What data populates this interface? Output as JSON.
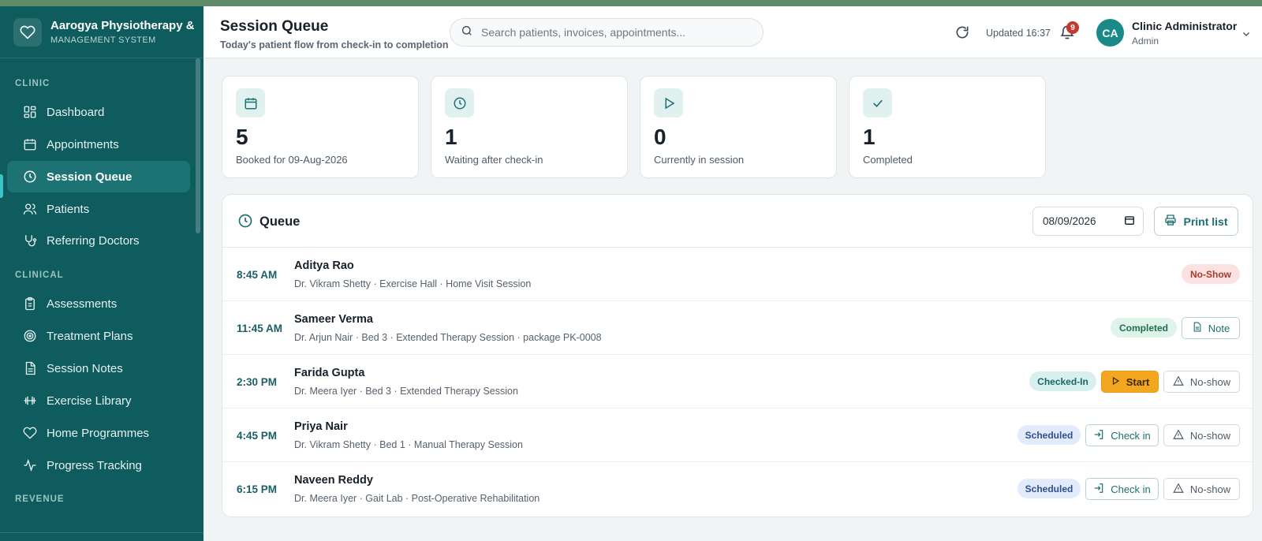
{
  "brand": {
    "name": "Aarogya Physiotherapy & I",
    "subtitle": "MANAGEMENT SYSTEM"
  },
  "sidebar": {
    "sections": [
      {
        "label": "CLINIC"
      },
      {
        "label": "CLINICAL"
      },
      {
        "label": "REVENUE"
      }
    ],
    "items": [
      {
        "label": "Dashboard",
        "icon": "dashboard-icon"
      },
      {
        "label": "Appointments",
        "icon": "calendar-icon"
      },
      {
        "label": "Session Queue",
        "icon": "clock-icon",
        "active": true
      },
      {
        "label": "Patients",
        "icon": "users-icon"
      },
      {
        "label": "Referring Doctors",
        "icon": "stethoscope-icon"
      },
      {
        "label": "Assessments",
        "icon": "clipboard-icon"
      },
      {
        "label": "Treatment Plans",
        "icon": "target-icon"
      },
      {
        "label": "Session Notes",
        "icon": "document-icon"
      },
      {
        "label": "Exercise Library",
        "icon": "dumbbell-icon"
      },
      {
        "label": "Home Programmes",
        "icon": "heart-icon"
      },
      {
        "label": "Progress Tracking",
        "icon": "activity-icon"
      }
    ]
  },
  "header": {
    "title": "Session Queue",
    "subtitle": "Today's patient flow from check-in to completion",
    "search_placeholder": "Search patients, invoices, appointments...",
    "updated": "Updated 16:37",
    "notifications": "9",
    "user": {
      "initials": "CA",
      "name": "Clinic Administrator",
      "role": "Admin"
    }
  },
  "stats": [
    {
      "value": "5",
      "label": "Booked for 09-Aug-2026",
      "icon": "calendar-icon"
    },
    {
      "value": "1",
      "label": "Waiting after check-in",
      "icon": "clock-icon"
    },
    {
      "value": "0",
      "label": "Currently in session",
      "icon": "play-icon"
    },
    {
      "value": "1",
      "label": "Completed",
      "icon": "check-icon"
    }
  ],
  "queue": {
    "title": "Queue",
    "date": "08/09/2026",
    "print_label": "Print list",
    "rows": [
      {
        "time": "8:45 AM",
        "name": "Aditya Rao",
        "details": "Dr. Vikram Shetty · Exercise Hall · Home Visit Session",
        "status": "No-Show"
      },
      {
        "time": "11:45 AM",
        "name": "Sameer Verma",
        "details": "Dr. Arjun Nair · Bed 3 · Extended Therapy Session · package PK-0008",
        "status": "Completed",
        "actions": [
          "Note"
        ]
      },
      {
        "time": "2:30 PM",
        "name": "Farida Gupta",
        "details": "Dr. Meera Iyer · Bed 3 · Extended Therapy Session",
        "status": "Checked-In",
        "actions": [
          "Start",
          "No-show"
        ]
      },
      {
        "time": "4:45 PM",
        "name": "Priya Nair",
        "details": "Dr. Vikram Shetty · Bed 1 · Manual Therapy Session",
        "status": "Scheduled",
        "actions": [
          "Check in",
          "No-show"
        ]
      },
      {
        "time": "6:15 PM",
        "name": "Naveen Reddy",
        "details": "Dr. Meera Iyer · Gait Lab · Post-Operative Rehabilitation",
        "status": "Scheduled",
        "actions": [
          "Check in",
          "No-show"
        ]
      }
    ]
  },
  "colors": {
    "sidebar": "#0f5c5e",
    "accent": "#1d6f70",
    "start": "#f3a61f"
  }
}
